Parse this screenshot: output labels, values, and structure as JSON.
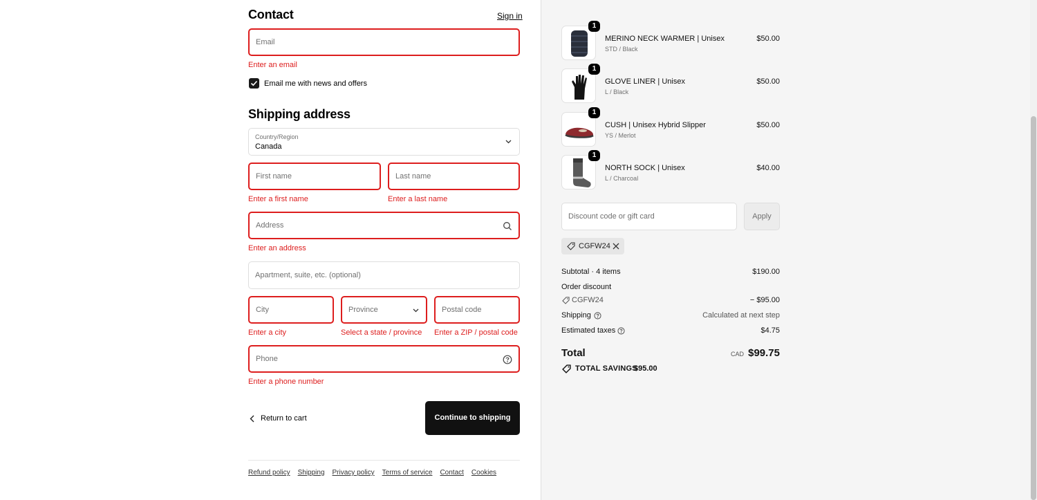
{
  "contact": {
    "title": "Contact",
    "sign_in": "Sign in",
    "email_placeholder": "Email",
    "email_error": "Enter an email",
    "newsletter_label": "Email me with news and offers"
  },
  "shipping": {
    "title": "Shipping address",
    "country_label": "Country/Region",
    "country_value": "Canada",
    "first_name_placeholder": "First name",
    "first_name_error": "Enter a first name",
    "last_name_placeholder": "Last name",
    "last_name_error": "Enter a last name",
    "address_placeholder": "Address",
    "address_error": "Enter an address",
    "apartment_placeholder": "Apartment, suite, etc. (optional)",
    "city_placeholder": "City",
    "city_error": "Enter a city",
    "province_placeholder": "Province",
    "province_error": "Select a state / province",
    "postal_placeholder": "Postal code",
    "postal_error": "Enter a ZIP / postal code",
    "phone_placeholder": "Phone",
    "phone_error": "Enter a phone number"
  },
  "actions": {
    "return_to_cart": "Return to cart",
    "continue": "Continue to shipping"
  },
  "footer": {
    "links": [
      "Refund policy",
      "Shipping",
      "Privacy policy",
      "Terms of service",
      "Contact",
      "Cookies"
    ]
  },
  "cart": {
    "items": [
      {
        "name": "MERINO NECK WARMER | Unisex",
        "variant": "STD / Black",
        "price": "$50.00",
        "qty": "1"
      },
      {
        "name": "GLOVE LINER | Unisex",
        "variant": "L / Black",
        "price": "$50.00",
        "qty": "1"
      },
      {
        "name": "CUSH | Unisex Hybrid Slipper",
        "variant": "YS / Merlot",
        "price": "$50.00",
        "qty": "1"
      },
      {
        "name": "NORTH SOCK | Unisex",
        "variant": "L / Charcoal",
        "price": "$40.00",
        "qty": "1"
      }
    ],
    "discount_placeholder": "Discount code or gift card",
    "apply_label": "Apply",
    "applied_code": "CGFW24"
  },
  "summary": {
    "subtotal_label": "Subtotal · 4 items",
    "subtotal_value": "$190.00",
    "order_discount_label": "Order discount",
    "discount_code": "CGFW24",
    "discount_value": "− $95.00",
    "shipping_label": "Shipping",
    "shipping_value": "Calculated at next step",
    "taxes_label": "Estimated taxes",
    "taxes_value": "$4.75",
    "total_label": "Total",
    "currency": "CAD",
    "total_value": "$99.75",
    "savings_label": "TOTAL SAVINGS",
    "savings_value": "$95.00"
  },
  "colors": {
    "error": "#dd1d1d",
    "primary_button": "#111111",
    "sidebar_bg": "#f5f5f5"
  }
}
